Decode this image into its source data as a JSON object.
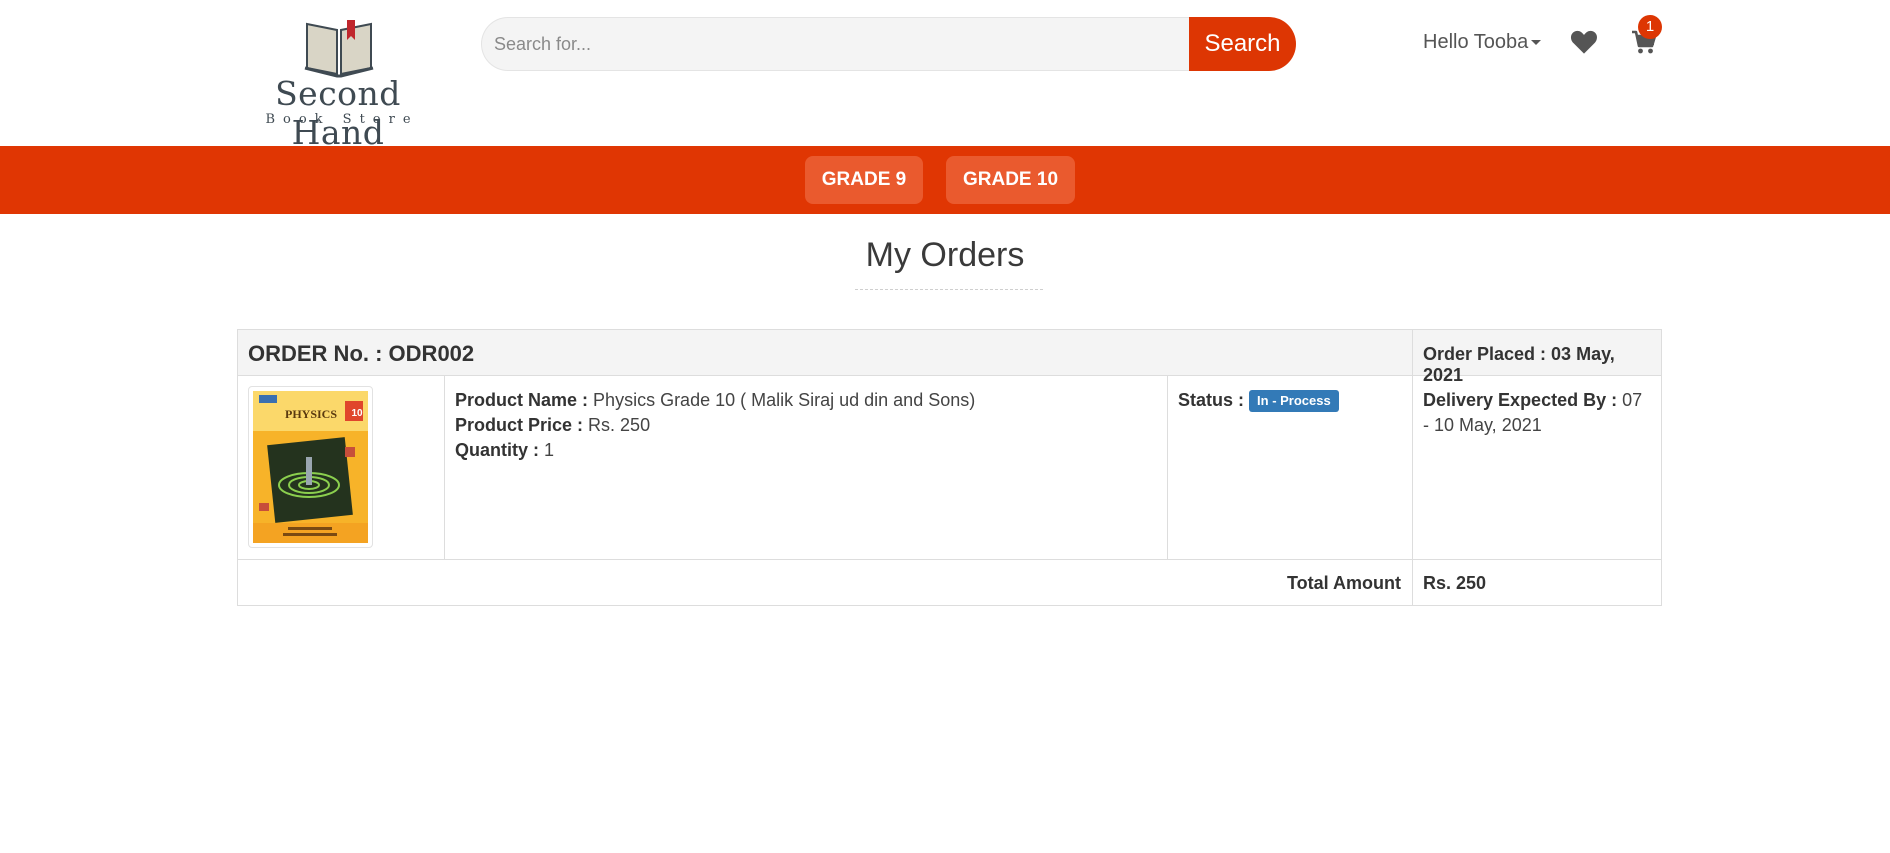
{
  "brand": {
    "title": "Second Hand",
    "subtitle": "Book Store"
  },
  "search": {
    "placeholder": "Search for...",
    "button_label": "Search"
  },
  "user": {
    "greeting": "Hello Tooba"
  },
  "cart": {
    "count": "1"
  },
  "nav": {
    "items": [
      {
        "label": "GRADE 9"
      },
      {
        "label": "GRADE 10"
      }
    ]
  },
  "page": {
    "title": "My Orders"
  },
  "order": {
    "number_label": "ORDER No. : ODR002",
    "placed_label": "Order Placed : 03 May, 2021",
    "product": {
      "name_label": "Product Name :",
      "name": "Physics Grade 10 ( Malik Siraj ud din and Sons)",
      "price_label": "Product Price :",
      "price": "Rs. 250",
      "quantity_label": "Quantity :",
      "quantity": "1",
      "cover_title": "PHYSICS",
      "cover_grade": "10"
    },
    "status_label": "Status :",
    "status": "In - Process",
    "delivery_label": "Delivery Expected By :",
    "delivery": "07 - 10 May, 2021",
    "total_label": "Total Amount",
    "total": "Rs. 250"
  },
  "colors": {
    "accent": "#dd3603",
    "nav_bg": "#e03603",
    "nav_btn": "#ea5a2e",
    "badge": "#337ab7"
  }
}
